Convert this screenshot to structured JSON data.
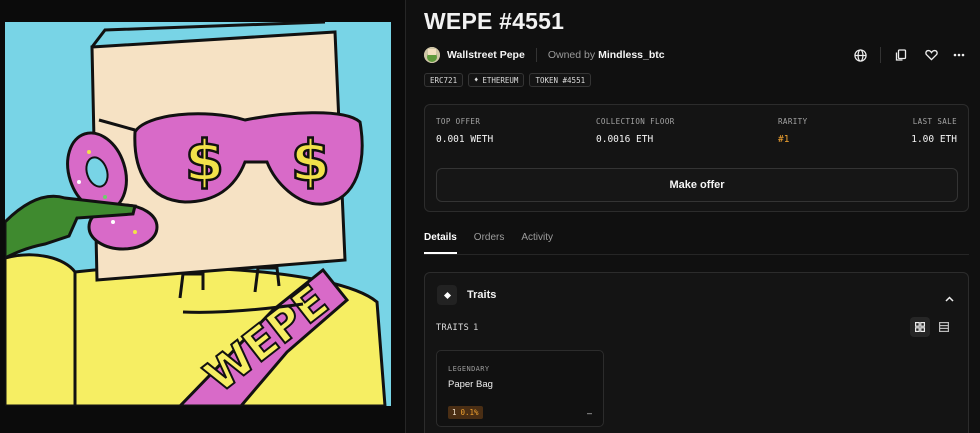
{
  "nft": {
    "title": "WEPE #4551",
    "collection_name": "Wallstreet Pepe",
    "owned_by_label": "Owned by",
    "owner": "Mindless_btc",
    "artwork_text": "WEPE"
  },
  "actions": {
    "icons": [
      "globe-icon",
      "copy-icon",
      "heart-icon",
      "more-icon"
    ]
  },
  "tags": {
    "standard": "ERC721",
    "chain": "ETHEREUM",
    "token": "TOKEN #4551"
  },
  "stats": {
    "top_offer_label": "TOP OFFER",
    "top_offer_value": "0.001 WETH",
    "floor_label": "COLLECTION FLOOR",
    "floor_value": "0.0016 ETH",
    "rarity_label": "RARITY",
    "rarity_value": "#1",
    "last_sale_label": "LAST SALE",
    "last_sale_value": "1.00 ETH",
    "make_offer_label": "Make offer"
  },
  "tabs": [
    "Details",
    "Orders",
    "Activity"
  ],
  "traits": {
    "title": "Traits",
    "count_label": "TRAITS",
    "count": "1",
    "items": [
      {
        "type": "LEGENDARY",
        "value": "Paper Bag",
        "count": "1",
        "percent": "0.1%",
        "price": "–"
      }
    ]
  },
  "colors": {
    "accent": "#f0a230",
    "background": "#101010",
    "art_sky": "#78d4e6",
    "art_shirt": "#f6ee63",
    "art_sash": "#d86ac8"
  }
}
